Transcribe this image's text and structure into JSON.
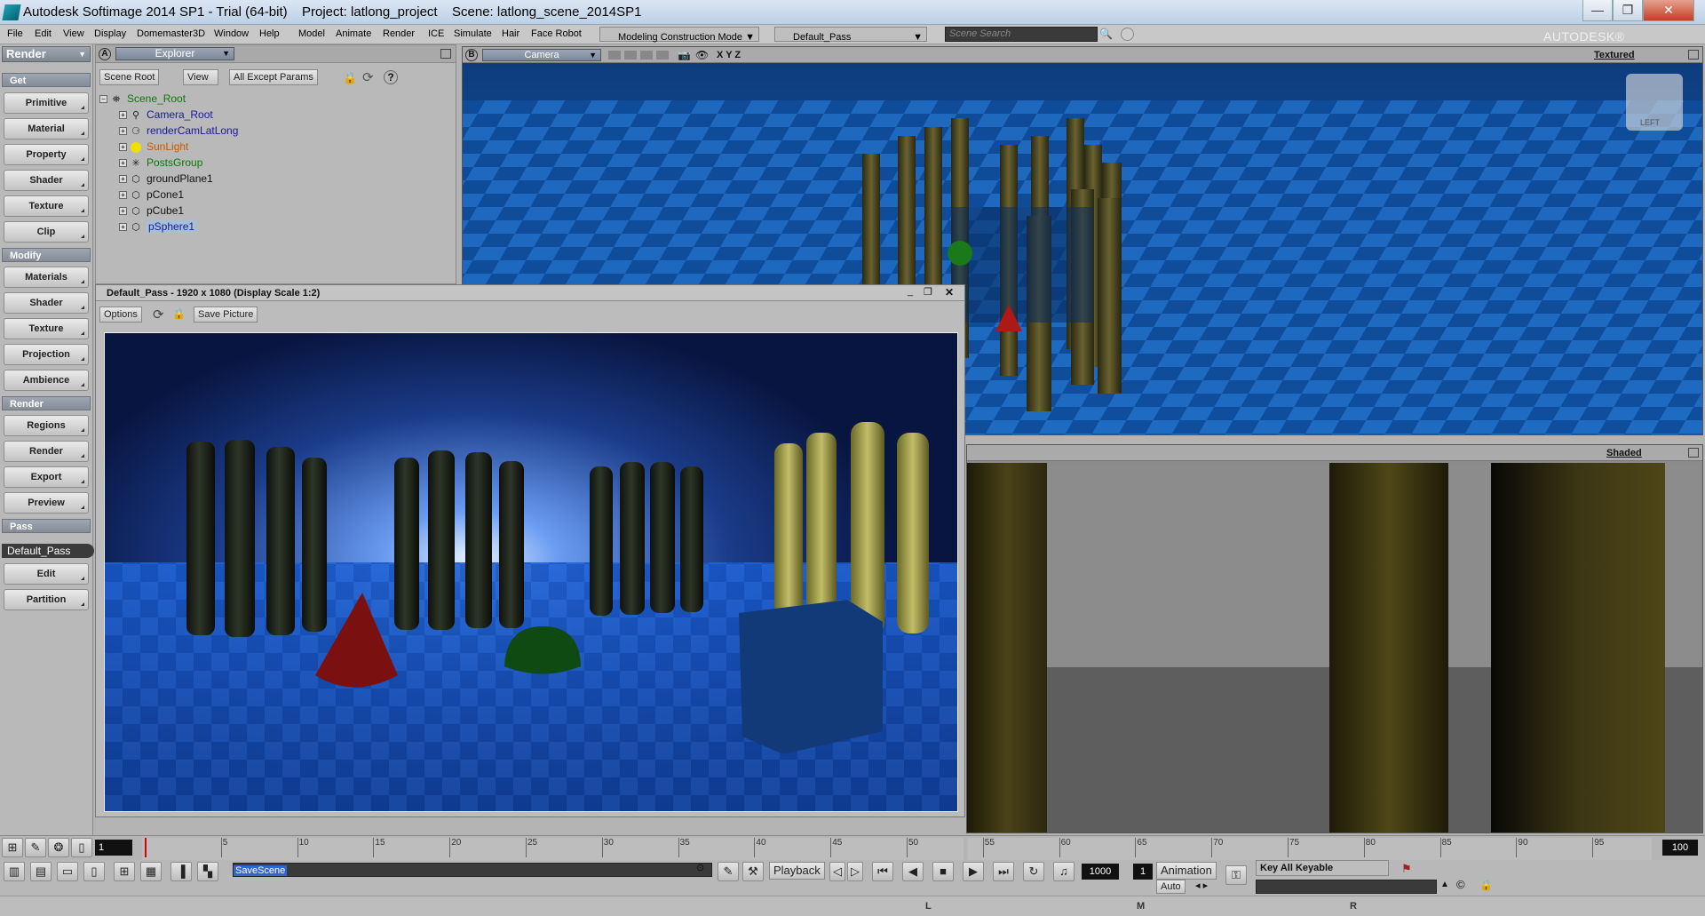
{
  "window": {
    "app_title": "Autodesk Softimage 2014 SP1  - Trial (64-bit)",
    "project": "Project: latlong_project",
    "scene": "Scene: latlong_scene_2014SP1",
    "minimize": "—",
    "maximize": "❐",
    "close": "✕"
  },
  "menu": {
    "items": [
      "File",
      "Edit",
      "View",
      "Display",
      "Domemaster3D",
      "Window",
      "Help",
      "Model",
      "Animate",
      "Render",
      "ICE",
      "Simulate",
      "Hair",
      "Face Robot"
    ],
    "mode_combo": "Modeling Construction Mode",
    "pass_combo": "Default_Pass",
    "scene_search_placeholder": "Scene Search",
    "brand": "AUTODESK® SOFTIMAGE®"
  },
  "left_panel": {
    "module": "Render",
    "sections": [
      {
        "title": "Get",
        "buttons": [
          "Primitive",
          "Material",
          "Property",
          "Shader",
          "Texture",
          "Clip"
        ]
      },
      {
        "title": "Modify",
        "buttons": [
          "Materials",
          "Shader",
          "Texture",
          "Projection",
          "Ambience"
        ]
      },
      {
        "title": "Render",
        "buttons": [
          "Regions",
          "Render",
          "Export",
          "Preview"
        ]
      },
      {
        "title": "Pass",
        "buttons": [
          "Edit",
          "Partition"
        ]
      }
    ],
    "pass_name": "Default_Pass"
  },
  "explorer": {
    "header_letter": "A",
    "title": "Explorer",
    "scope": "Scene Root",
    "view": "View",
    "filter": "All Except Params",
    "tree": [
      {
        "label": "Scene_Root",
        "color": "#0a7a0a",
        "level": 0,
        "icon": "scene-root-icon"
      },
      {
        "label": "Camera_Root",
        "color": "#1a1a9a",
        "level": 1,
        "icon": "camera-icon"
      },
      {
        "label": "renderCamLatLong",
        "color": "#1a1a9a",
        "level": 1,
        "icon": "camera-rig-icon"
      },
      {
        "label": "SunLight",
        "color": "#c85a00",
        "level": 1,
        "icon": "light-icon"
      },
      {
        "label": "PostsGroup",
        "color": "#0a7a0a",
        "level": 1,
        "icon": "null-icon"
      },
      {
        "label": "groundPlane1",
        "color": "#111111",
        "level": 1,
        "icon": "polymesh-icon"
      },
      {
        "label": "pCone1",
        "color": "#111111",
        "level": 1,
        "icon": "polymesh-icon"
      },
      {
        "label": "pCube1",
        "color": "#111111",
        "level": 1,
        "icon": "polymesh-icon"
      },
      {
        "label": "pSphere1",
        "color": "#1a1a9a",
        "level": 1,
        "icon": "polymesh-icon",
        "selected": true
      }
    ]
  },
  "viewport_top": {
    "letter": "B",
    "camera": "Camera",
    "axes": "X Y Z",
    "display_mode": "Textured",
    "cube_label": "LEFT"
  },
  "viewport_bottom": {
    "display_mode": "Shaded"
  },
  "render_window": {
    "title": "Default_Pass - 1920 x 1080 (Display Scale 1:2)",
    "options": "Options",
    "save_picture": "Save Picture"
  },
  "timeline": {
    "current_frame": "1",
    "ticks": [
      "5",
      "10",
      "15",
      "20",
      "25",
      "30",
      "35",
      "40",
      "45",
      "50",
      "55",
      "60",
      "65",
      "70",
      "75",
      "80",
      "85",
      "90",
      "95"
    ],
    "end_frame": "100"
  },
  "bottom": {
    "command": "SaveScene",
    "playback": "Playback",
    "fps": "1000",
    "frame": "1",
    "animation": "Animation",
    "auto": "Auto",
    "key_all_keyable": "Key All Keyable"
  },
  "status": {
    "l": "L",
    "m": "M",
    "r": "R"
  }
}
